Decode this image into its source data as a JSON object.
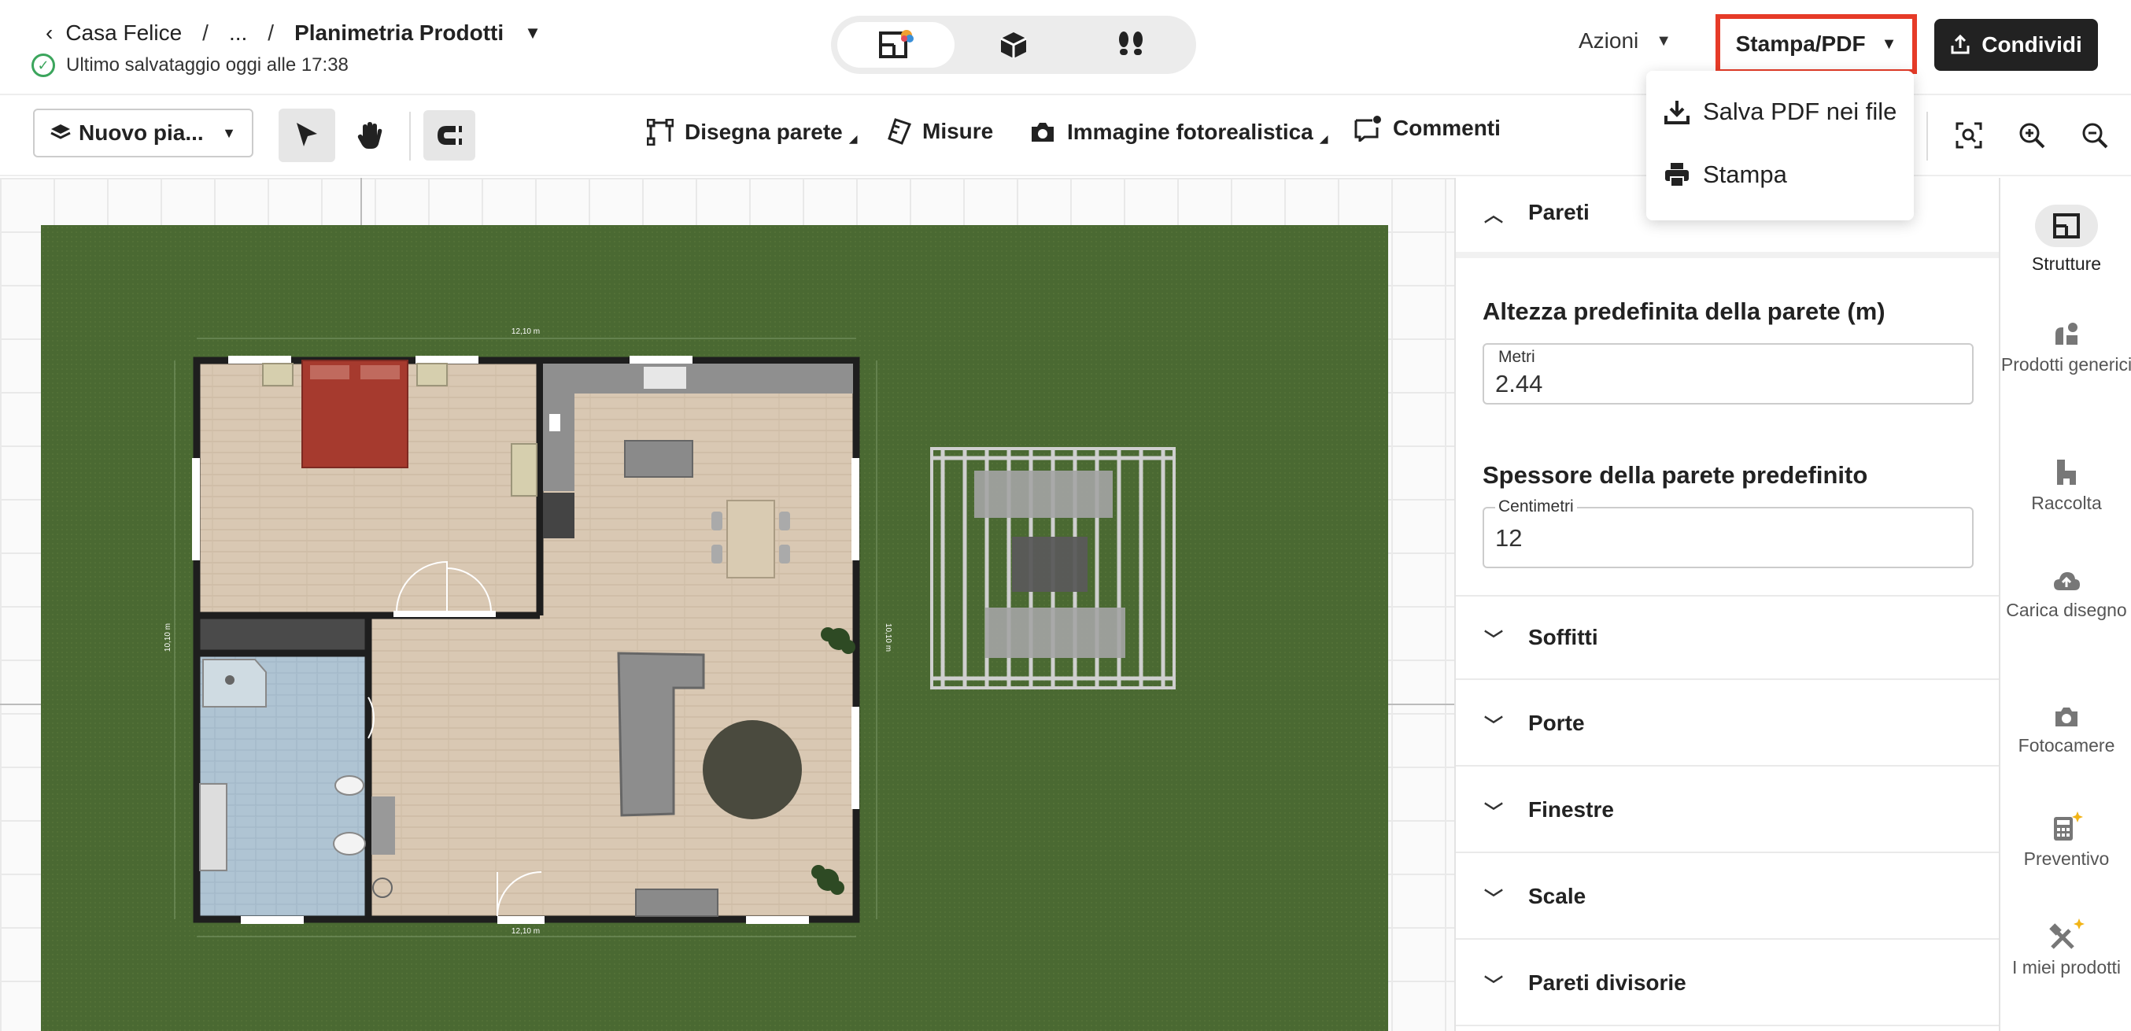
{
  "header": {
    "back_label": "Casa Felice",
    "sep1": "/",
    "ellipsis": "...",
    "sep2": "/",
    "doc_title": "Planimetria Prodotti",
    "save_status": "Ultimo salvataggio oggi alle 17:38",
    "actions_label": "Azioni",
    "print_label": "Stampa/PDF",
    "share_label": "Condividi",
    "view_modes": [
      "2d-plan-icon",
      "3d-box-icon",
      "walkthrough-footprints-icon"
    ]
  },
  "dropdown": {
    "items": [
      {
        "label": "Salva PDF nei file",
        "icon": "download-icon"
      },
      {
        "label": "Stampa",
        "icon": "printer-icon"
      }
    ]
  },
  "toolbar": {
    "level_label": "Nuovo pia...",
    "draw_wall": "Disegna parete",
    "measures": "Misure",
    "photo": "Immagine fotorealistica",
    "comments": "Commenti"
  },
  "canvas": {
    "dim_top": "12,10 m",
    "dim_bottom": "12,10 m",
    "dim_left": "10,10 m",
    "dim_right": "10,10 m"
  },
  "panel": {
    "walls_label": "Pareti",
    "height_title": "Altezza predefinita della parete (m)",
    "height_unit": "Metri",
    "height_value": "2.44",
    "thickness_title": "Spessore della parete predefinito",
    "thickness_unit": "Centimetri",
    "thickness_value": "12",
    "sections": [
      "Soffitti",
      "Porte",
      "Finestre",
      "Scale",
      "Pareti divisorie"
    ]
  },
  "sidebar": {
    "items": [
      {
        "label": "Strutture",
        "icon": "structures-icon"
      },
      {
        "label": "Prodotti generici",
        "icon": "generic-products-icon"
      },
      {
        "label": "Raccolta",
        "icon": "collection-icon"
      },
      {
        "label": "Carica disegno",
        "icon": "upload-cloud-icon"
      },
      {
        "label": "Fotocamere",
        "icon": "camera-icon"
      },
      {
        "label": "Preventivo",
        "icon": "calculator-icon"
      },
      {
        "label": "I miei prodotti",
        "icon": "my-products-icon"
      }
    ]
  },
  "colors": {
    "highlight": "#e63b28",
    "lawn": "#4a6932",
    "wall": "#1e1e1e",
    "bedspread": "#a63a2e",
    "bath_floor": "#aec4d2",
    "wood_floor": "#d8c6b0"
  }
}
